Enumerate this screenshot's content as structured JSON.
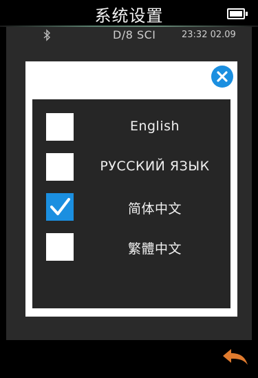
{
  "header": {
    "title": "系统设置",
    "battery_icon": "battery-full-icon"
  },
  "status": {
    "bluetooth_icon": "bluetooth-icon",
    "mode": "D/8  SCI",
    "datetime": "23:32 02.09"
  },
  "dialog": {
    "close_icon": "close-icon",
    "languages": [
      {
        "label": "English",
        "checked": false
      },
      {
        "label": "РУССКИЙ ЯЗЫК",
        "checked": false
      },
      {
        "label": "简体中文",
        "checked": true
      },
      {
        "label": "繁體中文",
        "checked": false
      }
    ]
  },
  "footer": {
    "back_icon": "back-arrow-icon"
  },
  "colors": {
    "accent": "#1b8fe0",
    "back_arrow": "#e07b2e",
    "panel": "#2a2a2a"
  }
}
